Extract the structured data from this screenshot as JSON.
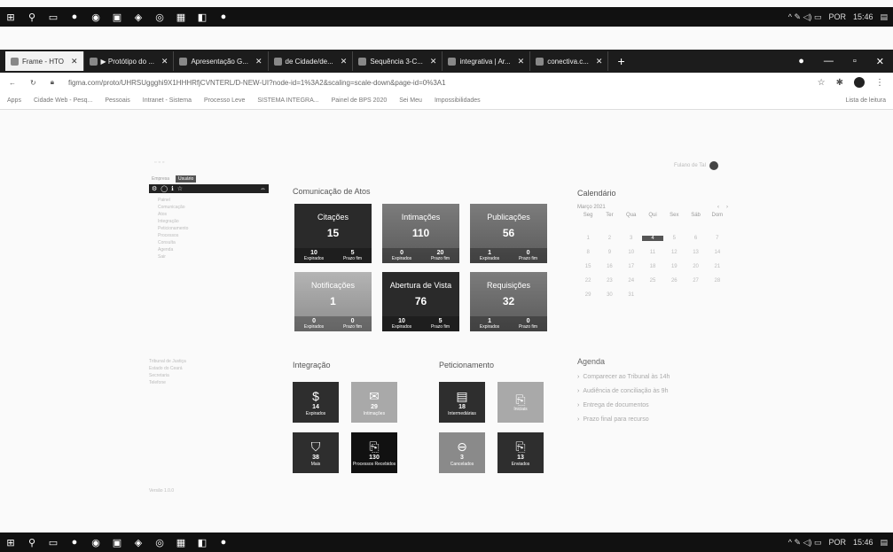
{
  "taskbar": {
    "lang": "POR",
    "time": "15:46"
  },
  "tabs": [
    {
      "label": "Frame - HTO",
      "active": true
    },
    {
      "label": "▶ Protótipo do ..."
    },
    {
      "label": "Apresentação G..."
    },
    {
      "label": "de Cidade/de..."
    },
    {
      "label": "Sequência 3-C..."
    },
    {
      "label": "integrativa | Ar..."
    },
    {
      "label": "conectiva.c..."
    }
  ],
  "address": {
    "url": "figma.com/proto/UHRSUggghi9X1HHHRfjCVNTERL/D-NEW-UI?node-id=1%3A2&scaling=scale-down&page-id=0%3A1"
  },
  "bookmarks": {
    "items": [
      "Apps",
      "Cidade Web - Pesq...",
      "Pessoais",
      "Intranet - Sistema",
      "Processo Leve",
      "SISTEMA INTEGRA...",
      "Painel de BPS 2020",
      "",
      "Sei Meu",
      "Impossibilidades"
    ],
    "right": "Lista de leitura"
  },
  "sidebar": {
    "tab_a": "Empresa",
    "tab_b": "Usuário",
    "items": [
      "Painel",
      "Comunicação",
      "Atos",
      "Integração",
      "Peticionamento",
      "Processos",
      "Consulta",
      "Agenda",
      "Sair"
    ],
    "bottom": [
      "Tribunal de Justiça",
      "Estado do Ceará",
      "Secretaria",
      "Telefone"
    ],
    "footer": [
      "Versão 1.0.0"
    ]
  },
  "user": {
    "label": "Fulano de Tal"
  },
  "sections": {
    "comunicacao": "Comunicação de Atos",
    "integracao": "Integração",
    "peticionamento": "Peticionamento",
    "calendario": "Calendário",
    "agenda": "Agenda"
  },
  "cards": [
    {
      "label": "Citações",
      "value": "15",
      "f1n": "10",
      "f1": "Expirados",
      "f2n": "5",
      "f2": "Prazo fim",
      "style": "dark"
    },
    {
      "label": "Intimações",
      "value": "110",
      "f1n": "0",
      "f1": "Expirados",
      "f2n": "20",
      "f2": "Prazo fim",
      "style": "grad"
    },
    {
      "label": "Publicações",
      "value": "56",
      "f1n": "1",
      "f1": "Expirados",
      "f2n": "0",
      "f2": "Prazo fim",
      "style": "grad"
    },
    {
      "label": "Notificações",
      "value": "1",
      "f1n": "0",
      "f1": "Expirados",
      "f2n": "0",
      "f2": "Prazo fim",
      "style": "light"
    },
    {
      "label": "Abertura de Vista",
      "value": "76",
      "f1n": "10",
      "f1": "Expirados",
      "f2n": "5",
      "f2": "Prazo fim",
      "style": "dark"
    },
    {
      "label": "Requisições",
      "value": "32",
      "f1n": "1",
      "f1": "Expirados",
      "f2n": "0",
      "f2": "Prazo fim",
      "style": "grad"
    }
  ],
  "integracao_tiles": [
    {
      "icon": "$",
      "num": "14",
      "label": "Expirados",
      "style": "dark"
    },
    {
      "icon": "✉",
      "num": "29",
      "label": "Intimações",
      "style": "light"
    },
    {
      "icon": "⛉",
      "num": "38",
      "label": "Mais",
      "style": "dark"
    },
    {
      "icon": "⎘",
      "num": "130",
      "label": "Processos Recebidos",
      "style": "black"
    }
  ],
  "peticionamento_tiles": [
    {
      "icon": "▤",
      "num": "18",
      "label": "Intermediárias",
      "style": "dark"
    },
    {
      "icon": "⎘",
      "num": "",
      "label": "Iniciais",
      "style": "light"
    },
    {
      "icon": "⊖",
      "num": "3",
      "label": "Cancelados",
      "style": "mid"
    },
    {
      "icon": "⎘",
      "num": "13",
      "label": "Enviados",
      "style": "dark"
    }
  ],
  "calendar": {
    "month": "Março 2021",
    "dows": [
      "Seg",
      "Ter",
      "Qua",
      "Qui",
      "Sex",
      "Sáb",
      "Dom"
    ],
    "days": [
      "",
      "",
      "",
      "",
      "",
      "",
      "",
      "1",
      "2",
      "3",
      "4",
      "5",
      "6",
      "7",
      "8",
      "9",
      "10",
      "11",
      "12",
      "13",
      "14",
      "15",
      "16",
      "17",
      "18",
      "19",
      "20",
      "21",
      "22",
      "23",
      "24",
      "25",
      "26",
      "27",
      "28",
      "29",
      "30",
      "31",
      "",
      "",
      "",
      ""
    ],
    "today": "4"
  },
  "agenda": {
    "items": [
      "Comparecer ao Tribunal às 14h",
      "Audiência de conciliação às 9h",
      "Entrega de documentos",
      "Prazo final para recurso"
    ]
  }
}
